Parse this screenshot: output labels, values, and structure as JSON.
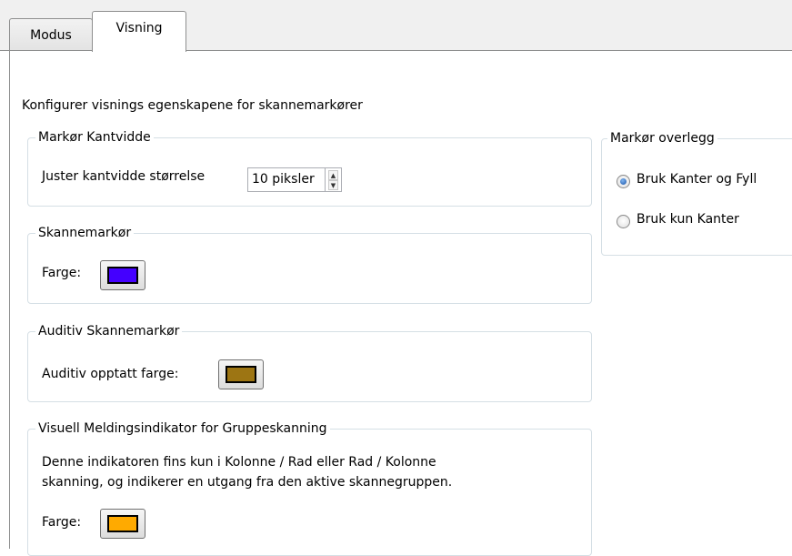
{
  "tabs": [
    {
      "label": "Modus",
      "active": false
    },
    {
      "label": "Visning",
      "active": true
    }
  ],
  "intro": "Konfigurer visnings egenskapene for skannemarkører",
  "border_width": {
    "legend": "Markør Kantvidde",
    "label": "Juster kantvidde størrelse",
    "value": "10 piksler"
  },
  "scan_marker": {
    "legend": "Skannemarkør",
    "color_label": "Farge:",
    "color": "#4400ff"
  },
  "auditory_marker": {
    "legend": "Auditiv Skannemarkør",
    "color_label": "Auditiv opptatt farge:",
    "color": "#9d7513"
  },
  "group_indicator": {
    "legend": "Visuell Meldingsindikator for Gruppeskanning",
    "description_line1": "Denne indikatoren fins kun i Kolonne / Rad eller Rad / Kolonne",
    "description_line2": "skanning, og indikerer en utgang fra den aktive skannegruppen.",
    "color_label": "Farge:",
    "color": "#ffaa00"
  },
  "overlay": {
    "legend": "Markør overlegg",
    "options": [
      {
        "label": "Bruk Kanter og Fyll",
        "selected": true
      },
      {
        "label": "Bruk kun Kanter",
        "selected": false
      }
    ]
  }
}
